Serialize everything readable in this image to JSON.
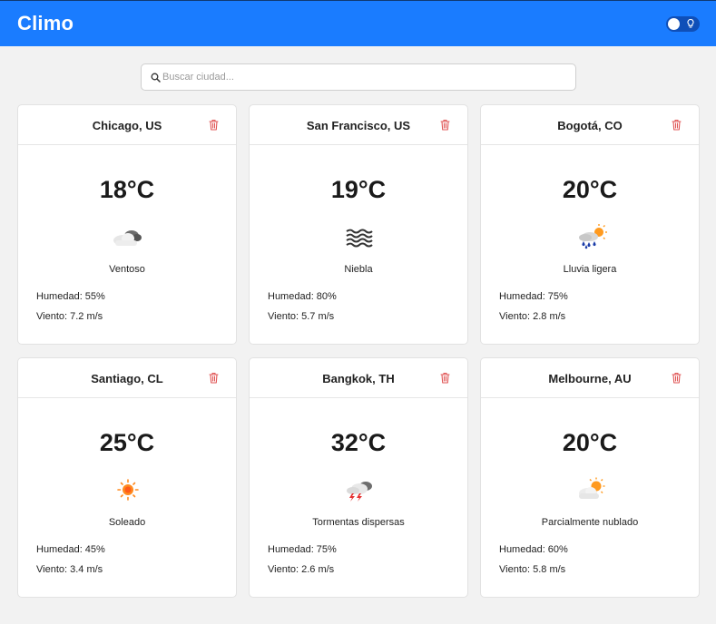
{
  "header": {
    "title": "Climo",
    "theme_toggle_icon": "lightbulb-icon",
    "accent": "#1a7cff"
  },
  "search": {
    "placeholder": "Buscar ciudad...",
    "value": "",
    "icon": "search-icon"
  },
  "cards": [
    {
      "city": "Chicago, US",
      "temp": "18°C",
      "icon": "cloudy-icon",
      "desc": "Ventoso",
      "humidity": "Humedad: 55%",
      "wind": "Viento: 7.2 m/s"
    },
    {
      "city": "San Francisco, US",
      "temp": "19°C",
      "icon": "fog-icon",
      "desc": "Niebla",
      "humidity": "Humedad: 80%",
      "wind": "Viento: 5.7 m/s"
    },
    {
      "city": "Bogotá, CO",
      "temp": "20°C",
      "icon": "light-rain-icon",
      "desc": "Lluvia ligera",
      "humidity": "Humedad: 75%",
      "wind": "Viento: 2.8 m/s"
    },
    {
      "city": "Santiago, CL",
      "temp": "25°C",
      "icon": "sun-icon",
      "desc": "Soleado",
      "humidity": "Humedad: 45%",
      "wind": "Viento: 3.4 m/s"
    },
    {
      "city": "Bangkok, TH",
      "temp": "32°C",
      "icon": "thunderstorm-icon",
      "desc": "Tormentas dispersas",
      "humidity": "Humedad: 75%",
      "wind": "Viento: 2.6 m/s"
    },
    {
      "city": "Melbourne, AU",
      "temp": "20°C",
      "icon": "partly-cloudy-icon",
      "desc": "Parcialmente nublado",
      "humidity": "Humedad: 60%",
      "wind": "Viento: 5.8 m/s"
    }
  ],
  "delete_icon": "trash-icon",
  "delete_color": "#e05555"
}
